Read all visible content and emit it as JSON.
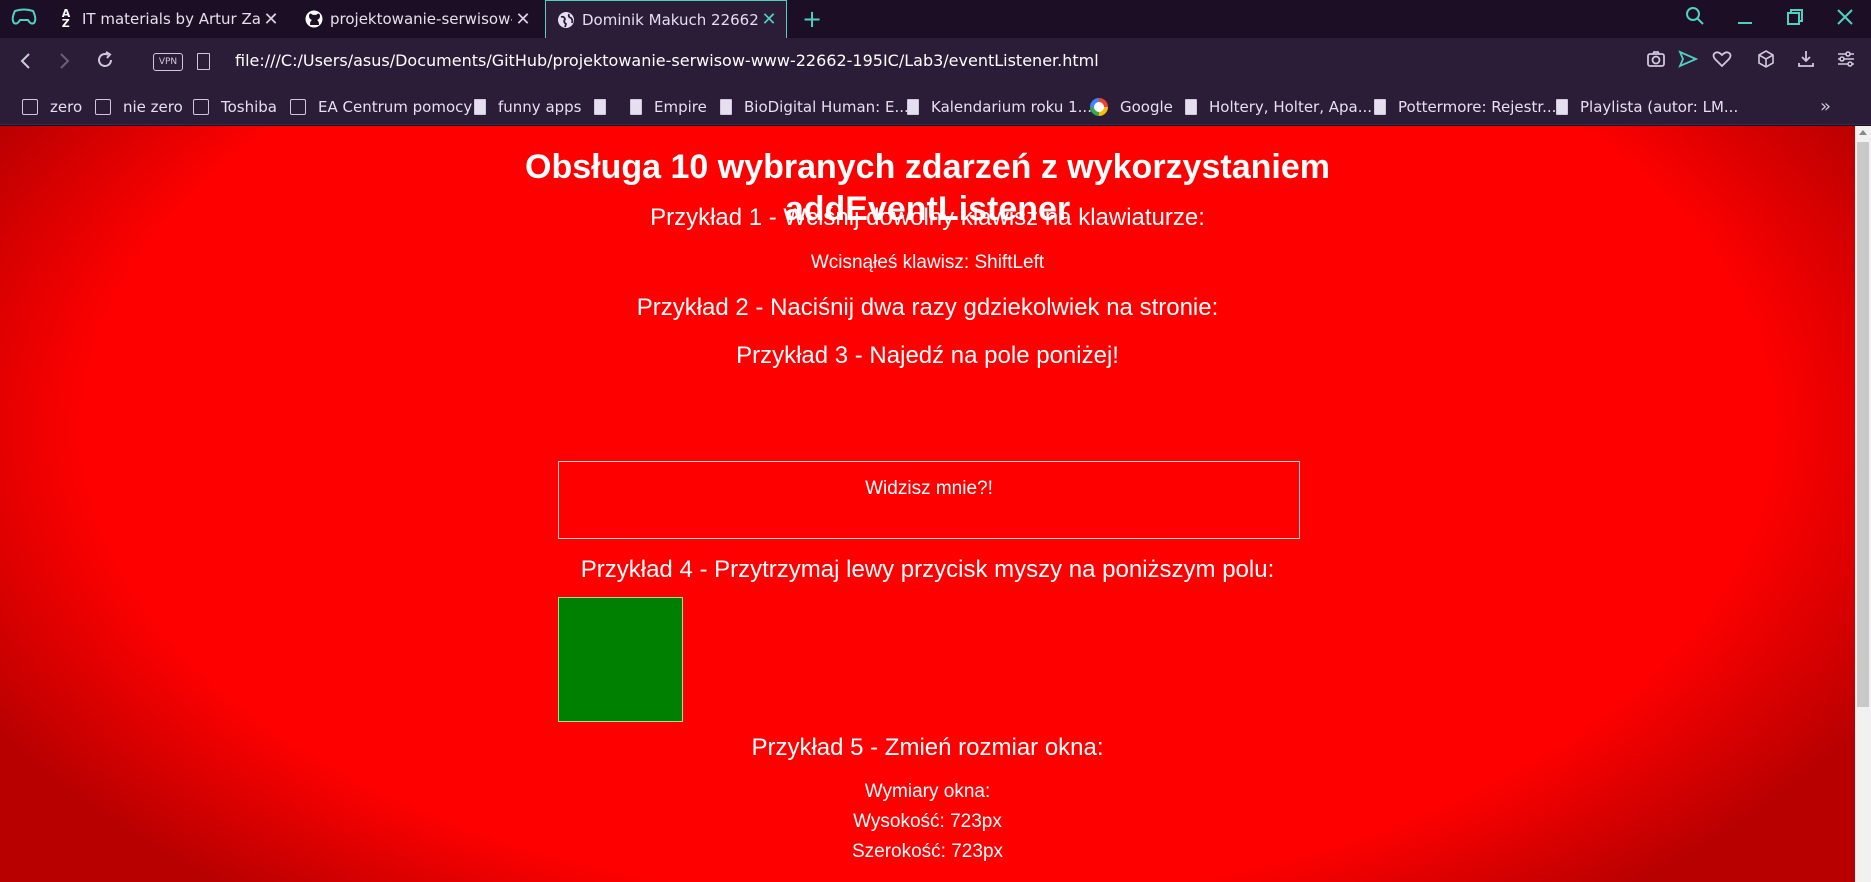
{
  "tabs": [
    {
      "label": "IT materials by Artur Zacniewski",
      "icon": "az-sort-icon",
      "active": false
    },
    {
      "label": "projektowanie-serwisow-www",
      "icon": "github-icon",
      "active": false
    },
    {
      "label": "Dominik Makuch 22662",
      "icon": "globe-icon",
      "active": true
    }
  ],
  "address": {
    "vpn_label": "VPN",
    "url": "file:///C:/Users/asus/Documents/GitHub/projektowanie-serwisow-www-22662-195IC/Lab3/eventListener.html"
  },
  "bookmarks": [
    {
      "label": "zero",
      "icon": "folder-icon"
    },
    {
      "label": "nie zero",
      "icon": "folder-icon"
    },
    {
      "label": "Toshiba",
      "icon": "folder-icon"
    },
    {
      "label": "EA Centrum pomocy",
      "icon": "folder-icon"
    },
    {
      "label": "funny apps",
      "icon": "page-icon"
    },
    {
      "label": "Empire",
      "icon": "page-icon"
    },
    {
      "label": "BioDigital Human: E...",
      "icon": "page-icon"
    },
    {
      "label": "Kalendarium roku 1...",
      "icon": "page-icon"
    },
    {
      "label": "Google",
      "icon": "google-icon"
    },
    {
      "label": "Holtery, Holter, Apa...",
      "icon": "page-icon"
    },
    {
      "label": "Pottermore: Rejestr...",
      "icon": "page-icon"
    },
    {
      "label": "Playlista (autor: LM...",
      "icon": "page-icon"
    }
  ],
  "page": {
    "title_line1": "Obsługa 10 wybranych zdarzeń z wykorzystaniem",
    "title_line2": "addEventListener",
    "ex1_heading": "Przykład 1 - Wciśnij dowolny klawisz na klawiaturze:",
    "ex1_result": "Wcisnąłeś klawisz: ShiftLeft",
    "ex2_heading": "Przykład 2 - Naciśnij dwa razy gdziekolwiek na stronie:",
    "ex3_heading": "Przykład 3 - Najedź na pole poniżej!",
    "ex3_box_text": "Widzisz mnie?!",
    "ex4_heading": "Przykład 4 - Przytrzymaj lewy przycisk myszy na poniższym polu:",
    "ex5_heading": "Przykład 5 - Zmień rozmiar okna:",
    "ex5_label": "Wymiary okna:",
    "ex5_height": "Wysokość: 723px",
    "ex5_width": "Szerokość: 723px"
  },
  "colors": {
    "page_background": "#ff0000",
    "green_square": "#008000",
    "browser_accent": "#4fd0c0"
  }
}
